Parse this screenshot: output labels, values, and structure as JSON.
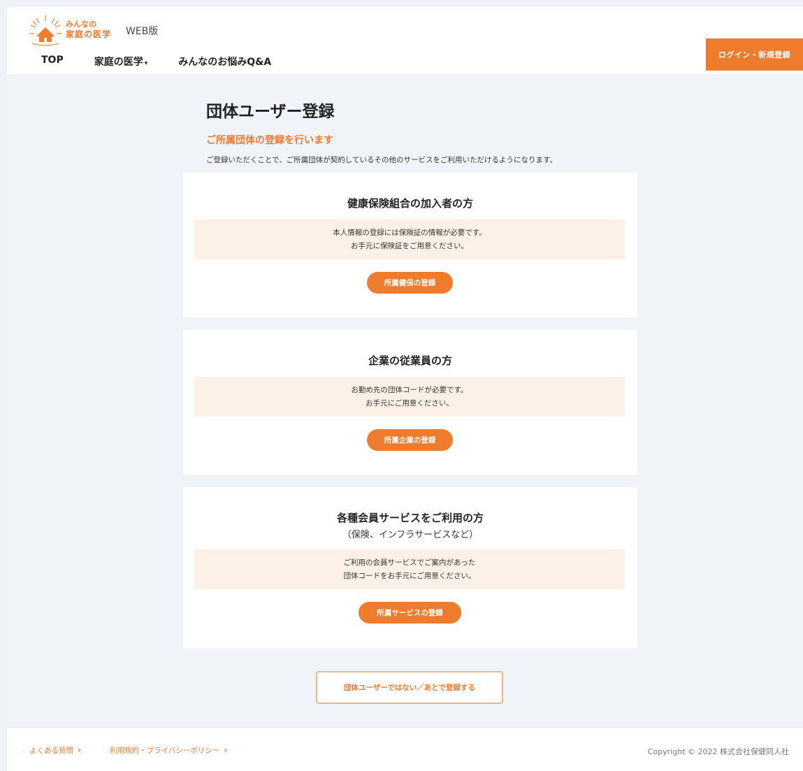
{
  "header": {
    "logo_line1": "みんなの",
    "logo_line2": "家庭の医学",
    "web_label": "WEB版",
    "nav": [
      {
        "label": "TOP"
      },
      {
        "label": "家庭の医学"
      },
      {
        "label": "みんなのお悩みQ&A"
      }
    ],
    "login_label": "ログイン・新規登録"
  },
  "main": {
    "title": "団体ユーザー登録",
    "subtitle": "ご所属団体の登録を行います",
    "lead": "ご登録いただくことで、ご所属団体が契約しているその他のサービスをご利用いただけるようになります。",
    "cards": [
      {
        "title": "健康保険組合の加入者の方",
        "note_line1": "本人情報の登録には保険証の情報が必要です。",
        "note_line2": "お手元に保険証をご用意ください。",
        "button": "所属健保の登録"
      },
      {
        "title": "企業の従業員の方",
        "note_line1": "お勤め先の団体コードが必要です。",
        "note_line2": "お手元にご用意ください。",
        "button": "所属企業の登録"
      },
      {
        "title": "各種会員サービスをご利用の方",
        "subtitle": "（保険、インフラサービスなど）",
        "note_line1": "ご利用の会員サービスでご案内があった",
        "note_line2": "団体コードをお手元にご用意ください。",
        "button": "所属サービスの登録"
      }
    ],
    "later_button": "団体ユーザーではない／あとで登録する"
  },
  "footer": {
    "faq": "よくある質問",
    "terms": "利用規約・プライバシーポリシー",
    "copyright": "Copyright © 2022 株式会社保健同人社"
  },
  "colors": {
    "accent": "#ef7b2d",
    "note_bg": "#fdf0e6",
    "page_bg": "#f0f3f8"
  }
}
